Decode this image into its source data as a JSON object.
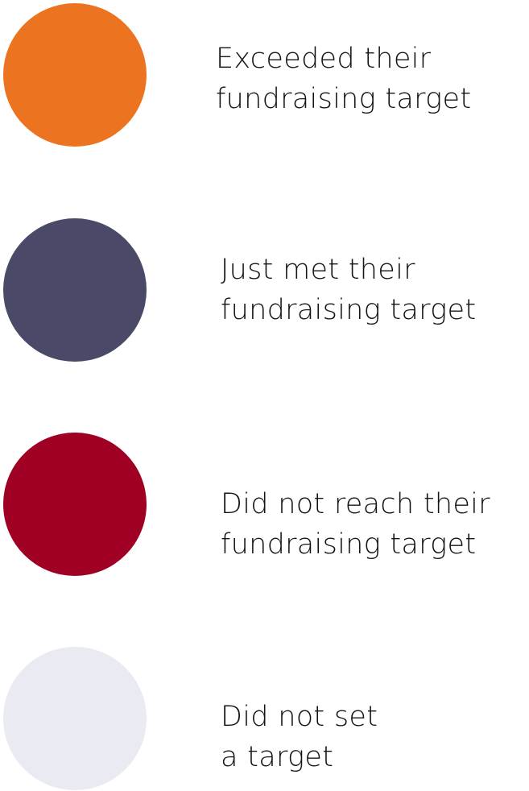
{
  "legend": {
    "items": [
      {
        "color": "#EC7420",
        "line1": "Exceeded their",
        "line2": "fundraising target"
      },
      {
        "color": "#4A4A68",
        "line1": "Just met their",
        "line2": "fundraising target"
      },
      {
        "color": "#A00024",
        "line1": "Did not reach their",
        "line2": "fundraising target"
      },
      {
        "color": "#EAEAF2",
        "line1": "Did not set",
        "line2": "a target"
      }
    ]
  }
}
